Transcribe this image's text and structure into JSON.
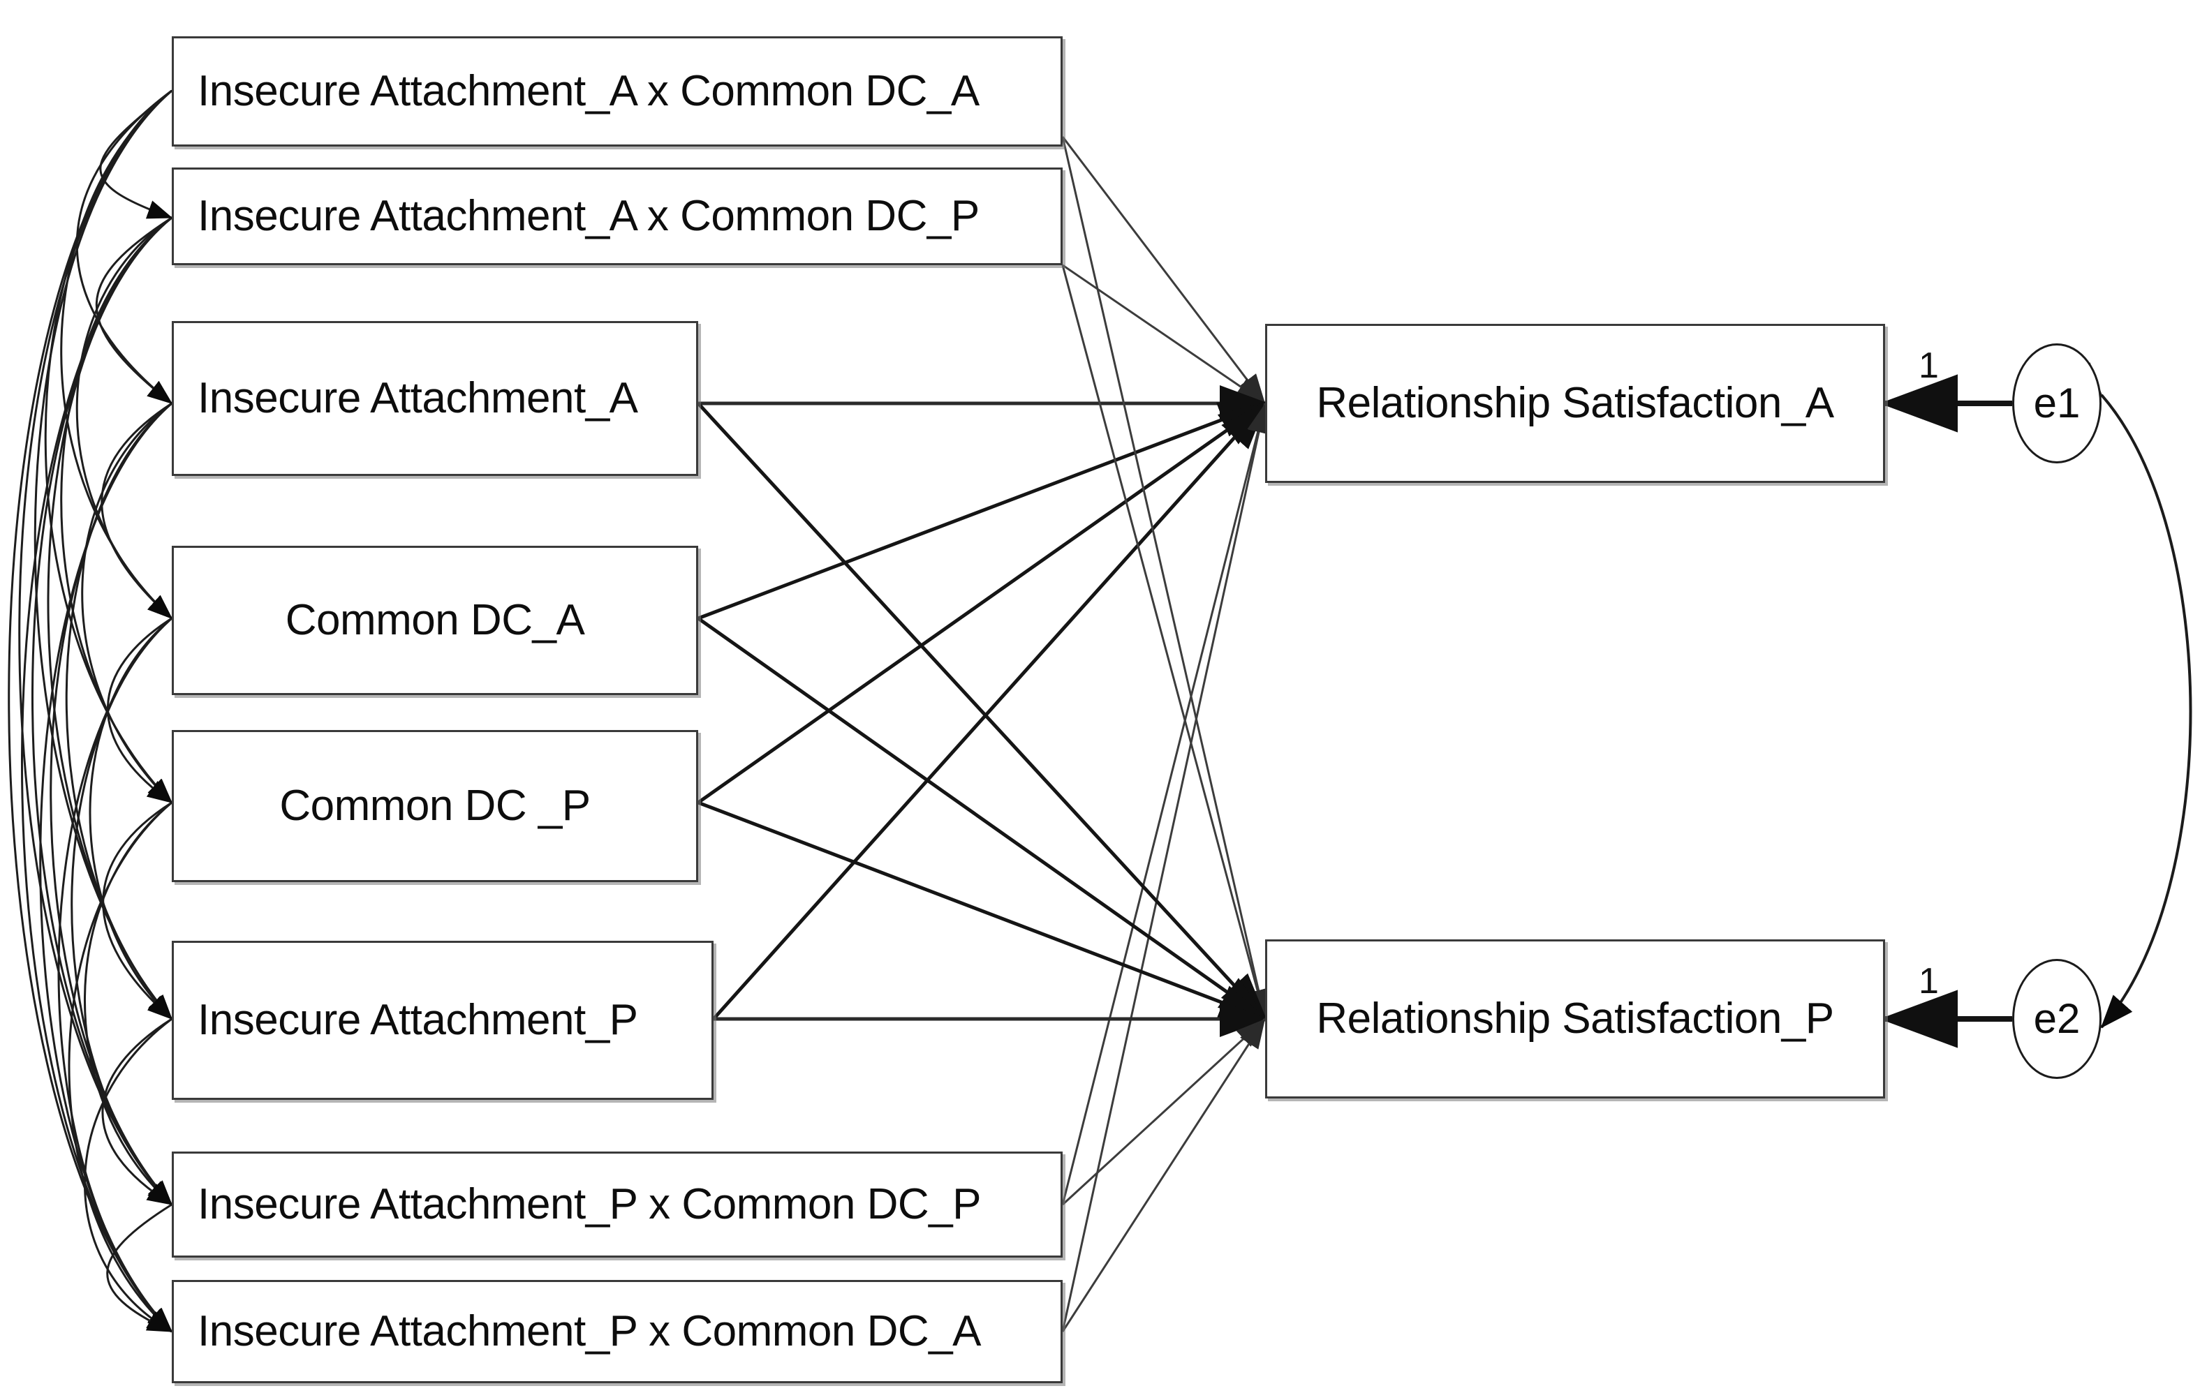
{
  "diagram": {
    "title": "Actor-Partner Interdependence Moderation Model path diagram",
    "type": "path-diagram",
    "background_color": "#ffffff",
    "line_color": "#1b1b1b",
    "box_border_color": "#3a3a3a",
    "predictors": [
      {
        "id": "ia_a_x_dc_a",
        "label": "Insecure Attachment_A x Common DC_A"
      },
      {
        "id": "ia_a_x_dc_p",
        "label": "Insecure Attachment_A x Common DC_P"
      },
      {
        "id": "ia_a",
        "label": "Insecure Attachment_A"
      },
      {
        "id": "dc_a",
        "label": "Common DC_A"
      },
      {
        "id": "dc_p",
        "label": "Common DC _P"
      },
      {
        "id": "ia_p",
        "label": "Insecure Attachment_P"
      },
      {
        "id": "ia_p_x_dc_p",
        "label": "Insecure Attachment_P x Common DC_P"
      },
      {
        "id": "ia_p_x_dc_a",
        "label": "Insecure Attachment_P x Common DC_A"
      }
    ],
    "outcomes": [
      {
        "id": "rs_a",
        "label": "Relationship Satisfaction_A"
      },
      {
        "id": "rs_p",
        "label": "Relationship Satisfaction_P"
      }
    ],
    "errors": [
      {
        "id": "e1",
        "label": "e1",
        "weight": "1"
      },
      {
        "id": "e2",
        "label": "e2",
        "weight": "1"
      }
    ],
    "notes": {
      "covariances": "All eight predictor variables are linked by double-headed curved covariance arrows on the left.",
      "error_covariance": "e1 and e2 are linked by a double-headed curved arrow on the right.",
      "regressions": "Every predictor has a single-headed path arrow to both Relationship Satisfaction_A and Relationship Satisfaction_P."
    }
  }
}
